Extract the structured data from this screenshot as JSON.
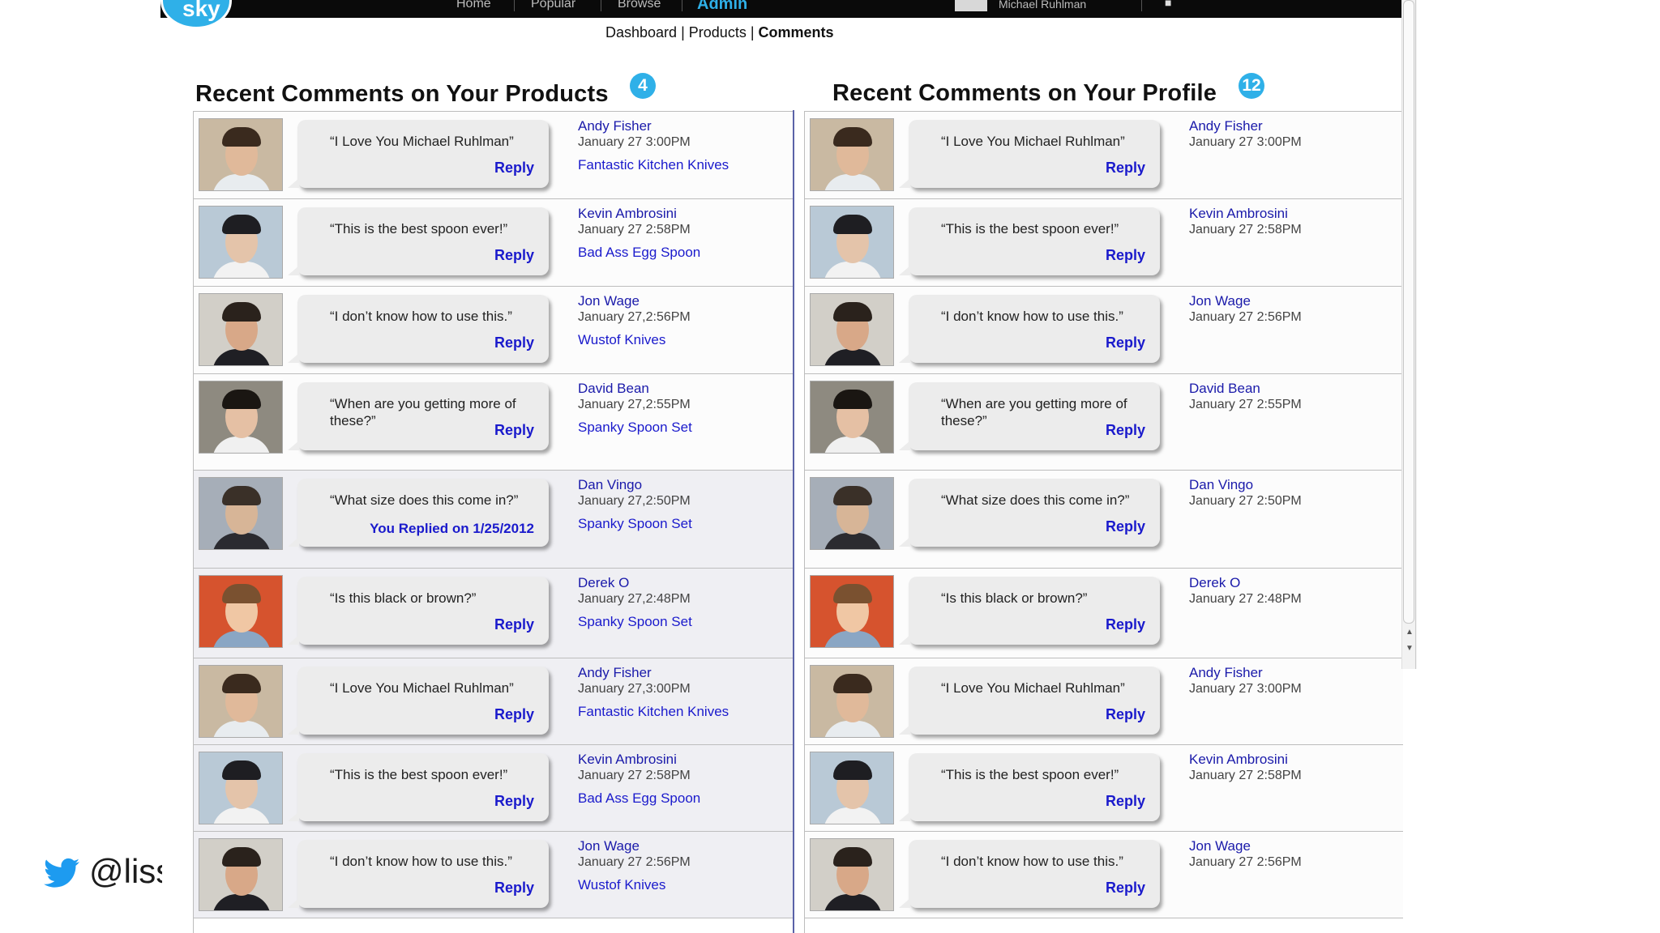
{
  "nav": {
    "logo_text": "sky",
    "items": [
      "Home",
      "Popular",
      "Browse",
      "Admin"
    ],
    "user": "Michael Ruhlman"
  },
  "breadcrumb": {
    "dashboard": "Dashboard",
    "sep1": "|",
    "products": "Products",
    "sep2": "|",
    "comments": "Comments"
  },
  "products_section": {
    "title": "Recent Comments on Your Products",
    "count": "4",
    "comments": [
      {
        "quote": "“I Love You Michael Ruhlman”",
        "name": "Andy Fisher",
        "date": "January 27 3:00PM",
        "product": "Fantastic Kitchen Knives",
        "action": "Reply",
        "replied": false
      },
      {
        "quote": "“This is the best spoon ever!”",
        "name": "Kevin Ambrosini",
        "date": "January 27 2:58PM",
        "product": "Bad Ass Egg Spoon",
        "action": "Reply",
        "replied": false
      },
      {
        "quote": "“I don’t know how to use this.”",
        "name": "Jon Wage",
        "date": "January 27,2:56PM",
        "product": "Wustof Knives",
        "action": "Reply",
        "replied": false
      },
      {
        "quote": "“When are you getting more of these?”",
        "name": "David Bean",
        "date": "January 27,2:55PM",
        "product": "Spanky Spoon Set",
        "action": "Reply",
        "replied": false
      },
      {
        "quote": "“What size does this come in?”",
        "name": "Dan Vingo",
        "date": "January 27,2:50PM",
        "product": "Spanky Spoon Set",
        "action": "You Replied on 1/25/2012",
        "replied": true
      },
      {
        "quote": "“Is this black or brown?”",
        "name": "Derek O",
        "date": "January 27,2:48PM",
        "product": "Spanky Spoon Set",
        "action": "Reply",
        "replied": true
      },
      {
        "quote": "“I Love You Michael Ruhlman”",
        "name": "Andy Fisher",
        "date": "January 27,3:00PM",
        "product": "Fantastic Kitchen Knives",
        "action": "Reply",
        "replied": true
      },
      {
        "quote": "“This is the best spoon ever!”",
        "name": "Kevin Ambrosini",
        "date": "January 27  2:58PM",
        "product": "Bad Ass Egg Spoon",
        "action": "Reply",
        "replied": true
      },
      {
        "quote": "“I don’t know how to use this.”",
        "name": "Jon Wage",
        "date": "January 27 2:56PM",
        "product": "Wustof Knives",
        "action": "Reply",
        "replied": true
      }
    ]
  },
  "profile_section": {
    "title": "Recent Comments on Your Profile",
    "count": "12",
    "comments": [
      {
        "quote": "“I Love You Michael Ruhlman”",
        "name": "Andy Fisher",
        "date": "January 27 3:00PM",
        "action": "Reply"
      },
      {
        "quote": "“This is the best spoon ever!”",
        "name": "Kevin Ambrosini",
        "date": "January 27 2:58PM",
        "action": "Reply"
      },
      {
        "quote": "“I don’t know how to use this.”",
        "name": "Jon Wage",
        "date": "January 27 2:56PM",
        "action": "Reply"
      },
      {
        "quote": "“When are you getting more of these?”",
        "name": "David Bean",
        "date": "January 27 2:55PM",
        "action": "Reply"
      },
      {
        "quote": "“What size does this come in?”",
        "name": "Dan Vingo",
        "date": "January 27  2:50PM",
        "action": "Reply"
      },
      {
        "quote": "“Is this black or brown?”",
        "name": "Derek O",
        "date": "January 27 2:48PM",
        "action": "Reply"
      },
      {
        "quote": "“I Love You Michael Ruhlman”",
        "name": "Andy Fisher",
        "date": "January 27 3:00PM",
        "action": "Reply"
      },
      {
        "quote": "“This is the best spoon ever!”",
        "name": "Kevin Ambrosini",
        "date": "January 27  2:58PM",
        "action": "Reply"
      },
      {
        "quote": "“I don’t know how to use this.”",
        "name": "Jon Wage",
        "date": "January 27 2:56PM",
        "action": "Reply"
      }
    ]
  },
  "overlay": {
    "twitter_handle": "@liss"
  },
  "colors": {
    "accent": "#2fb0e8",
    "link": "#1a1acc",
    "topbar": "#0a0a0a"
  }
}
